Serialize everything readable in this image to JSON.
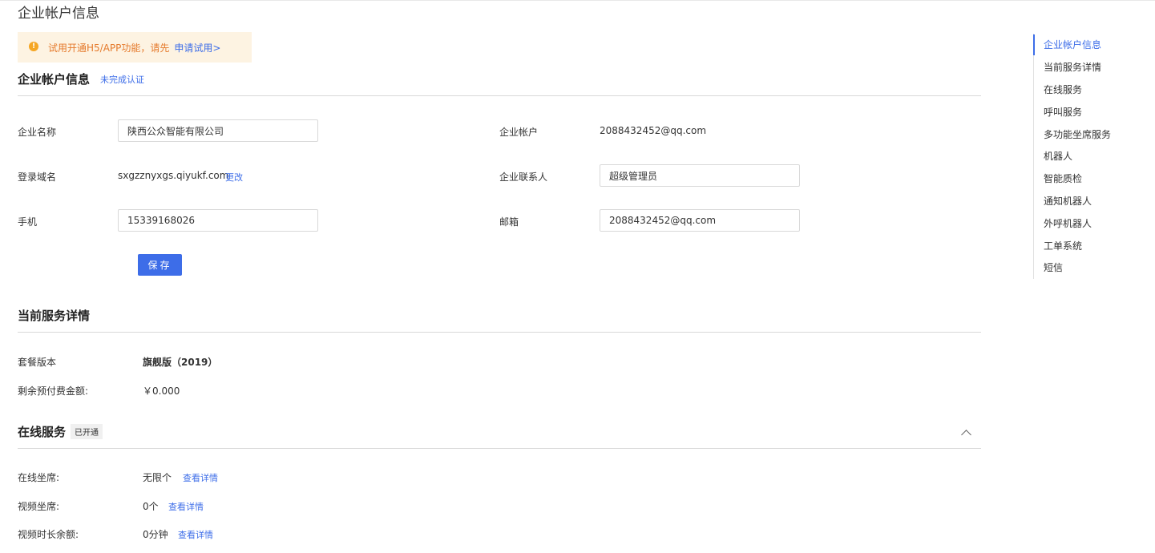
{
  "page": {
    "title": "企业帐户信息"
  },
  "alert": {
    "text": "试用开通H5/APP功能，请先",
    "link": "申请试用>"
  },
  "account": {
    "title": "企业帐户信息",
    "status": "未完成认证",
    "company_name_label": "企业名称",
    "company_name_value": "陕西公众智能有限公司",
    "account_label": "企业帐户",
    "account_value": "2088432452@qq.com",
    "domain_label": "登录域名",
    "domain_value": "sxgzznyxgs.qiyukf.com",
    "domain_change": "更改",
    "contact_label": "企业联系人",
    "contact_value": "超级管理员",
    "phone_label": "手机",
    "phone_value": "15339168026",
    "email_label": "邮箱",
    "email_value": "2088432452@qq.com",
    "save_label": "保存"
  },
  "service": {
    "title": "当前服务详情",
    "package_label": "套餐版本",
    "package_value": "旗舰版（2019）",
    "balance_label": "剩余预付费金额:",
    "balance_value": "￥0.000"
  },
  "online": {
    "title": "在线服务",
    "tag": "已开通",
    "seats_label": "在线坐席:",
    "seats_value": "无限个",
    "video_label": "视频坐席:",
    "video_value": "0个",
    "video_time_label": "视频时长余额:",
    "video_time_value": "0分钟",
    "detail_link": "查看详情"
  },
  "side_nav": {
    "items": [
      "企业帐户信息",
      "当前服务详情",
      "在线服务",
      "呼叫服务",
      "多功能坐席服务",
      "机器人",
      "智能质检",
      "通知机器人",
      "外呼机器人",
      "工单系统",
      "短信"
    ]
  },
  "colors": {
    "accent": "#3d6de8",
    "warning": "#f5a623",
    "warning_bg": "#fdf3e2"
  }
}
